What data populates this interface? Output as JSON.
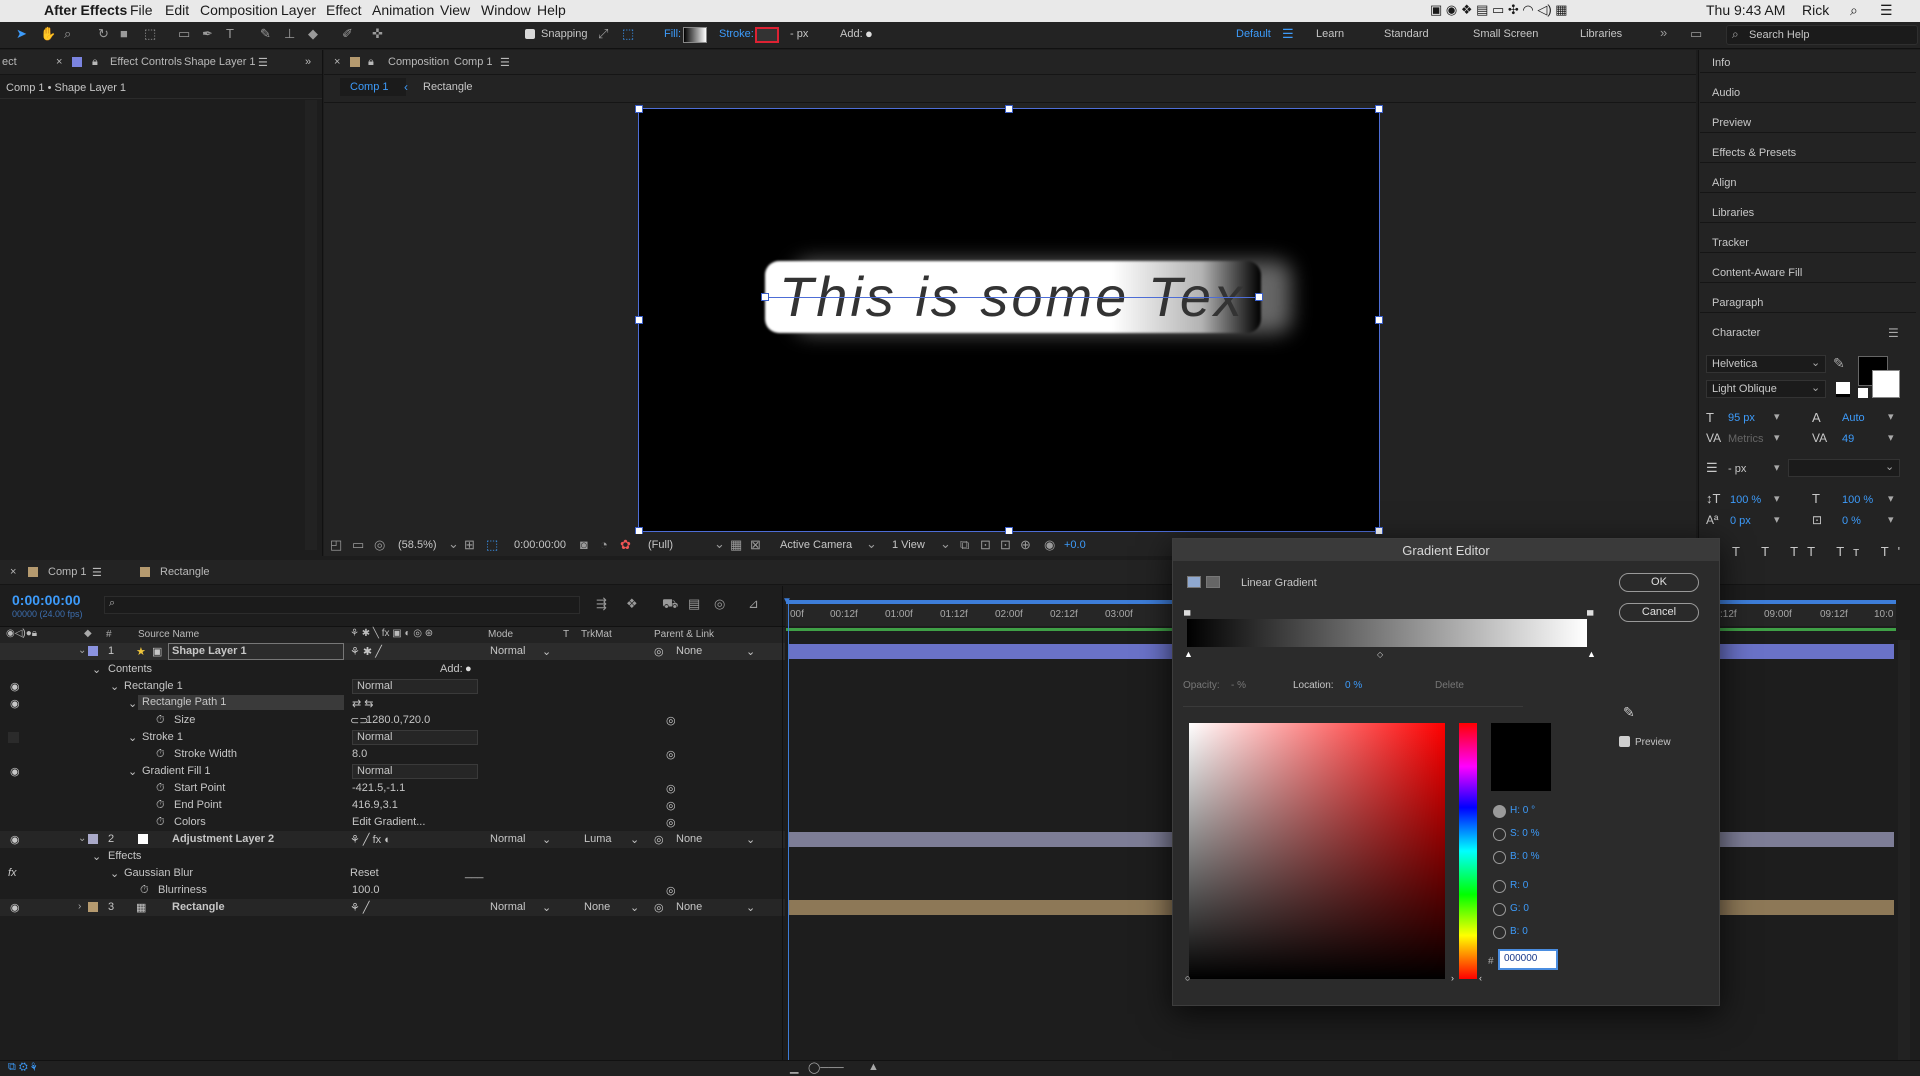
{
  "menubar": {
    "app_name": "After Effects",
    "items": [
      "File",
      "Edit",
      "Composition",
      "Layer",
      "Effect",
      "Animation",
      "View",
      "Window",
      "Help"
    ],
    "clock": "Thu 9:43 AM",
    "user": "Rick"
  },
  "toolbar": {
    "snapping_label": "Snapping",
    "fill_label": "Fill:",
    "stroke_label": "Stroke:",
    "stroke_px": "- px",
    "add_label": "Add:",
    "workspaces": [
      "Default",
      "Learn",
      "Standard",
      "Small Screen",
      "Libraries"
    ],
    "active_workspace": "Default",
    "search_placeholder": "Search Help"
  },
  "effect_controls": {
    "tab_cut": "ect",
    "tab_prefix": "Effect Controls",
    "tab_layer": "Shape Layer 1",
    "subtitle": "Comp 1 • Shape Layer 1"
  },
  "composition": {
    "tab_prefix": "Composition",
    "tab_comp": "Comp 1",
    "nav_active": "Comp 1",
    "nav_other": "Rectangle",
    "canvas_text": "This is some Tex",
    "zoom": "(58.5%)",
    "timecode": "0:00:00:00",
    "resolution": "(Full)",
    "camera": "Active Camera",
    "view": "1 View",
    "exposure": "+0.0"
  },
  "right_panel": {
    "items": [
      "Info",
      "Audio",
      "Preview",
      "Effects & Presets",
      "Align",
      "Libraries",
      "Tracker",
      "Content-Aware Fill",
      "Paragraph"
    ],
    "character_title": "Character",
    "font_family": "Helvetica",
    "font_style": "Light Oblique",
    "font_size": "95 px",
    "leading": "Auto",
    "kerning": "Metrics",
    "tracking": "49",
    "stroke_px": "- px",
    "vert_scale": "100 %",
    "horiz_scale": "100 %",
    "baseline": "0 px",
    "tsume": "0 %"
  },
  "timeline": {
    "tab_active": "Comp 1",
    "tab_other": "Rectangle",
    "timecode": "0:00:00:00",
    "fps": "00000 (24.00 fps)",
    "col_source": "Source Name",
    "col_mode": "Mode",
    "col_t": "T",
    "col_trkmat": "TrkMat",
    "col_parent": "Parent & Link",
    "ruler": [
      "00f",
      "00:12f",
      "01:00f",
      "01:12f",
      "02:00f",
      "02:12f",
      "03:00f",
      ":12f",
      "09:00f",
      "09:12f",
      "10:0"
    ],
    "layers": [
      {
        "num": "1",
        "name": "Shape Layer 1",
        "mode": "Normal",
        "trkmat": "",
        "parent": "None",
        "color": "#8b93e0"
      },
      {
        "num": "2",
        "name": "Adjustment Layer 2",
        "mode": "Normal",
        "trkmat": "Luma",
        "parent": "None",
        "color": "#a9a9c8"
      },
      {
        "num": "3",
        "name": "Rectangle",
        "mode": "Normal",
        "trkmat": "None",
        "parent": "None",
        "color": "#b59a6f"
      }
    ],
    "props": {
      "contents": "Contents",
      "add": "Add:",
      "rect1": "Rectangle 1",
      "rect1_mode": "Normal",
      "rectpath": "Rectangle Path 1",
      "size": "Size",
      "size_val": "1280.0,720.0",
      "stroke1": "Stroke 1",
      "stroke1_mode": "Normal",
      "stroke_width": "Stroke Width",
      "stroke_width_val": "8.0",
      "gradfill": "Gradient Fill 1",
      "gradfill_mode": "Normal",
      "start_point": "Start Point",
      "start_val": "-421.5,-1.1",
      "end_point": "End Point",
      "end_val": "416.9,3.1",
      "colors": "Colors",
      "colors_val": "Edit Gradient...",
      "effects": "Effects",
      "gaussian": "Gaussian Blur",
      "reset": "Reset",
      "blurriness": "Blurriness",
      "blurriness_val": "100.0"
    }
  },
  "gradient_editor": {
    "title": "Gradient Editor",
    "type_label": "Linear Gradient",
    "ok": "OK",
    "cancel": "Cancel",
    "opacity_label": "Opacity:",
    "opacity_val": "- %",
    "location_label": "Location:",
    "location_val": "0 %",
    "delete": "Delete",
    "preview_label": "Preview",
    "h": "H: 0 °",
    "s": "S: 0 %",
    "b": "B: 0 %",
    "r": "R: 0",
    "g": "G: 0",
    "bb": "B: 0",
    "hex_prefix": "#",
    "hex": "000000"
  }
}
